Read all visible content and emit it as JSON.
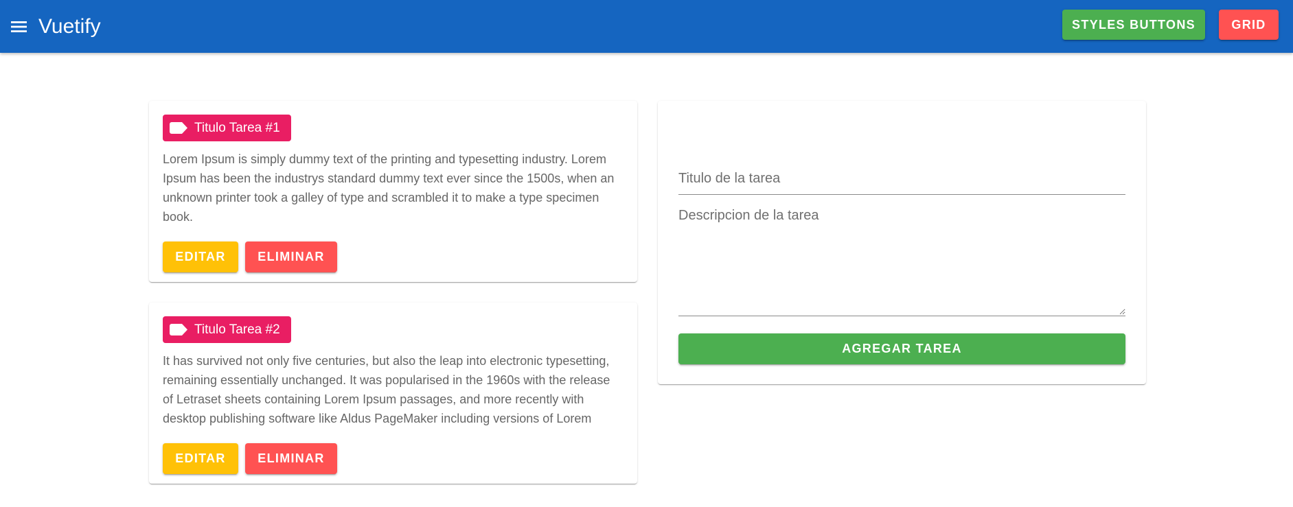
{
  "app": {
    "title": "Vuetify",
    "menu_icon": "menu-icon"
  },
  "header_actions": {
    "styles_buttons_label": "STYLES BUTTONS",
    "grid_label": "GRID"
  },
  "tasks": [
    {
      "title": "Titulo Tarea #1",
      "description": "Lorem Ipsum is simply dummy text of the printing and typesetting industry. Lorem Ipsum has been the industrys standard dummy text ever since the 1500s, when an unknown printer took a galley of type and scrambled it to make a type specimen book.",
      "edit_label": "EDITAR",
      "delete_label": "ELIMINAR"
    },
    {
      "title": "Titulo Tarea #2",
      "description": "It has survived not only five centuries, but also the leap into electronic typesetting, remaining essentially unchanged. It was popularised in the 1960s with the release of Letraset sheets containing Lorem Ipsum passages, and more recently with desktop publishing software like Aldus PageMaker including versions of Lorem Ipsum.",
      "edit_label": "EDITAR",
      "delete_label": "ELIMINAR"
    }
  ],
  "form": {
    "title_placeholder": "Titulo de la tarea",
    "title_value": "",
    "description_placeholder": "Descripcion de la tarea",
    "description_value": "",
    "submit_label": "AGREGAR TAREA"
  },
  "colors": {
    "appbar": "#1565c0",
    "success": "#4caf50",
    "error": "#ff5252",
    "warning": "#ffc107",
    "chip": "#e91e63"
  }
}
